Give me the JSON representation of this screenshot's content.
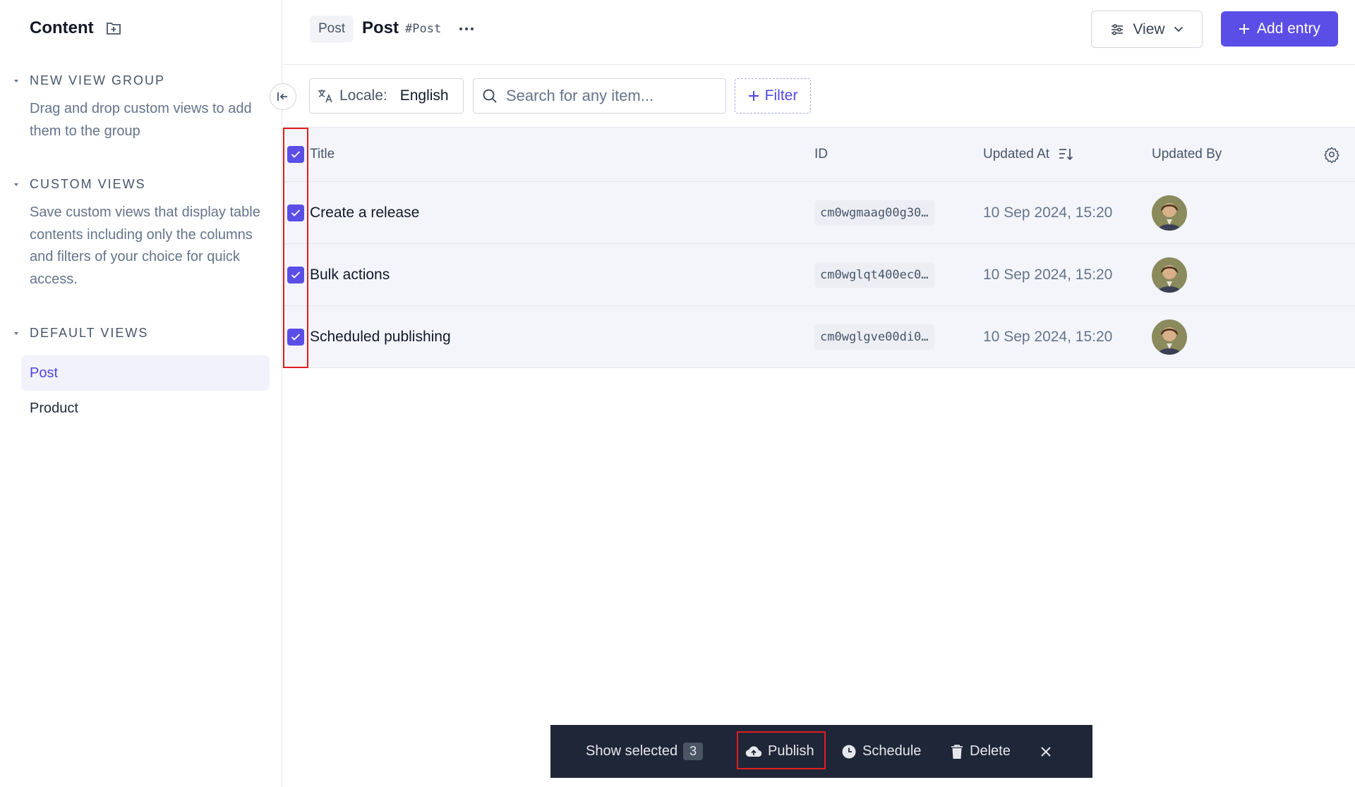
{
  "sidebar": {
    "title": "Content",
    "groups": [
      {
        "title": "NEW VIEW GROUP",
        "description": "Drag and drop custom views to add them to the group"
      },
      {
        "title": "CUSTOM VIEWS",
        "description": "Save custom views that display table contents including only the columns and filters of your choice for quick access."
      },
      {
        "title": "DEFAULT VIEWS",
        "description": ""
      }
    ],
    "items": [
      {
        "label": "Post",
        "active": true
      },
      {
        "label": "Product",
        "active": false
      }
    ]
  },
  "header": {
    "breadcrumb_tag": "Post",
    "title": "Post",
    "api_id": "#Post",
    "view_label": "View",
    "add_label": "Add entry"
  },
  "filters": {
    "locale_label": "Locale:",
    "locale_value": "English",
    "search_placeholder": "Search for any item...",
    "filter_label": "Filter"
  },
  "table": {
    "columns": {
      "title": "Title",
      "id": "ID",
      "updated_at": "Updated At",
      "updated_by": "Updated By"
    },
    "rows": [
      {
        "title": "Create a release",
        "id": "cm0wgmaag00g30…",
        "updated_at": "10 Sep 2024, 15:20"
      },
      {
        "title": "Bulk actions",
        "id": "cm0wglqt400ec0…",
        "updated_at": "10 Sep 2024, 15:20"
      },
      {
        "title": "Scheduled publishing",
        "id": "cm0wglgve00di0…",
        "updated_at": "10 Sep 2024, 15:20"
      }
    ]
  },
  "bulk": {
    "show_selected": "Show selected",
    "count": "3",
    "publish": "Publish",
    "schedule": "Schedule",
    "delete": "Delete"
  },
  "colors": {
    "accent": "#5b4ee6",
    "highlight": "#e11d1d",
    "bulkbar": "#1f2638"
  }
}
